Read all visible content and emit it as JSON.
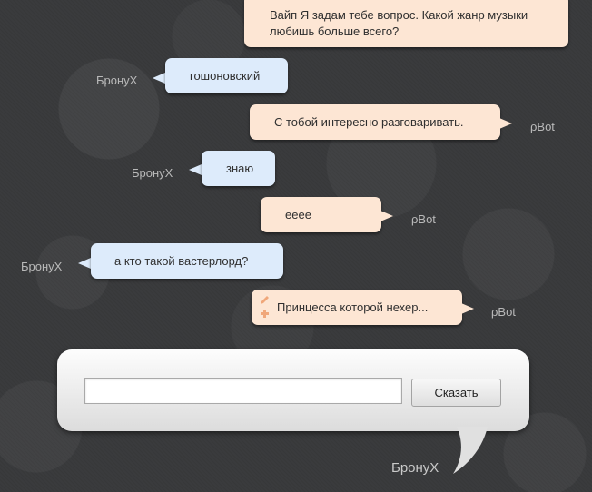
{
  "messages": [
    {
      "text_line1": "Вайп Я задам тебе вопрос. Какой жанр музыки",
      "text_line2": "любишь больше всего?"
    },
    {
      "author": "БронуХ",
      "text": "гошоновский"
    },
    {
      "author": "ρBot",
      "text": "С тобой интересно разговаривать."
    },
    {
      "author": "БронуХ",
      "text": "знаю"
    },
    {
      "author": "ρBot",
      "text": "ееее"
    },
    {
      "author": "БронуХ",
      "text": "а кто такой вастерлорд?"
    },
    {
      "author": "ρBot",
      "text": "Принцесса которой нехер..."
    }
  ],
  "composer": {
    "input_value": "",
    "input_placeholder": "",
    "button_label": "Сказать",
    "current_user": "БронуХ"
  },
  "colors": {
    "bot_bubble": "#fde6d4",
    "user_bubble": "#ddebfb",
    "background": "#3a3b3d",
    "author_text": "#b9b9b9",
    "edit_icon": "#f0a77a"
  },
  "icons": [
    "pencil-icon",
    "plus-icon"
  ]
}
